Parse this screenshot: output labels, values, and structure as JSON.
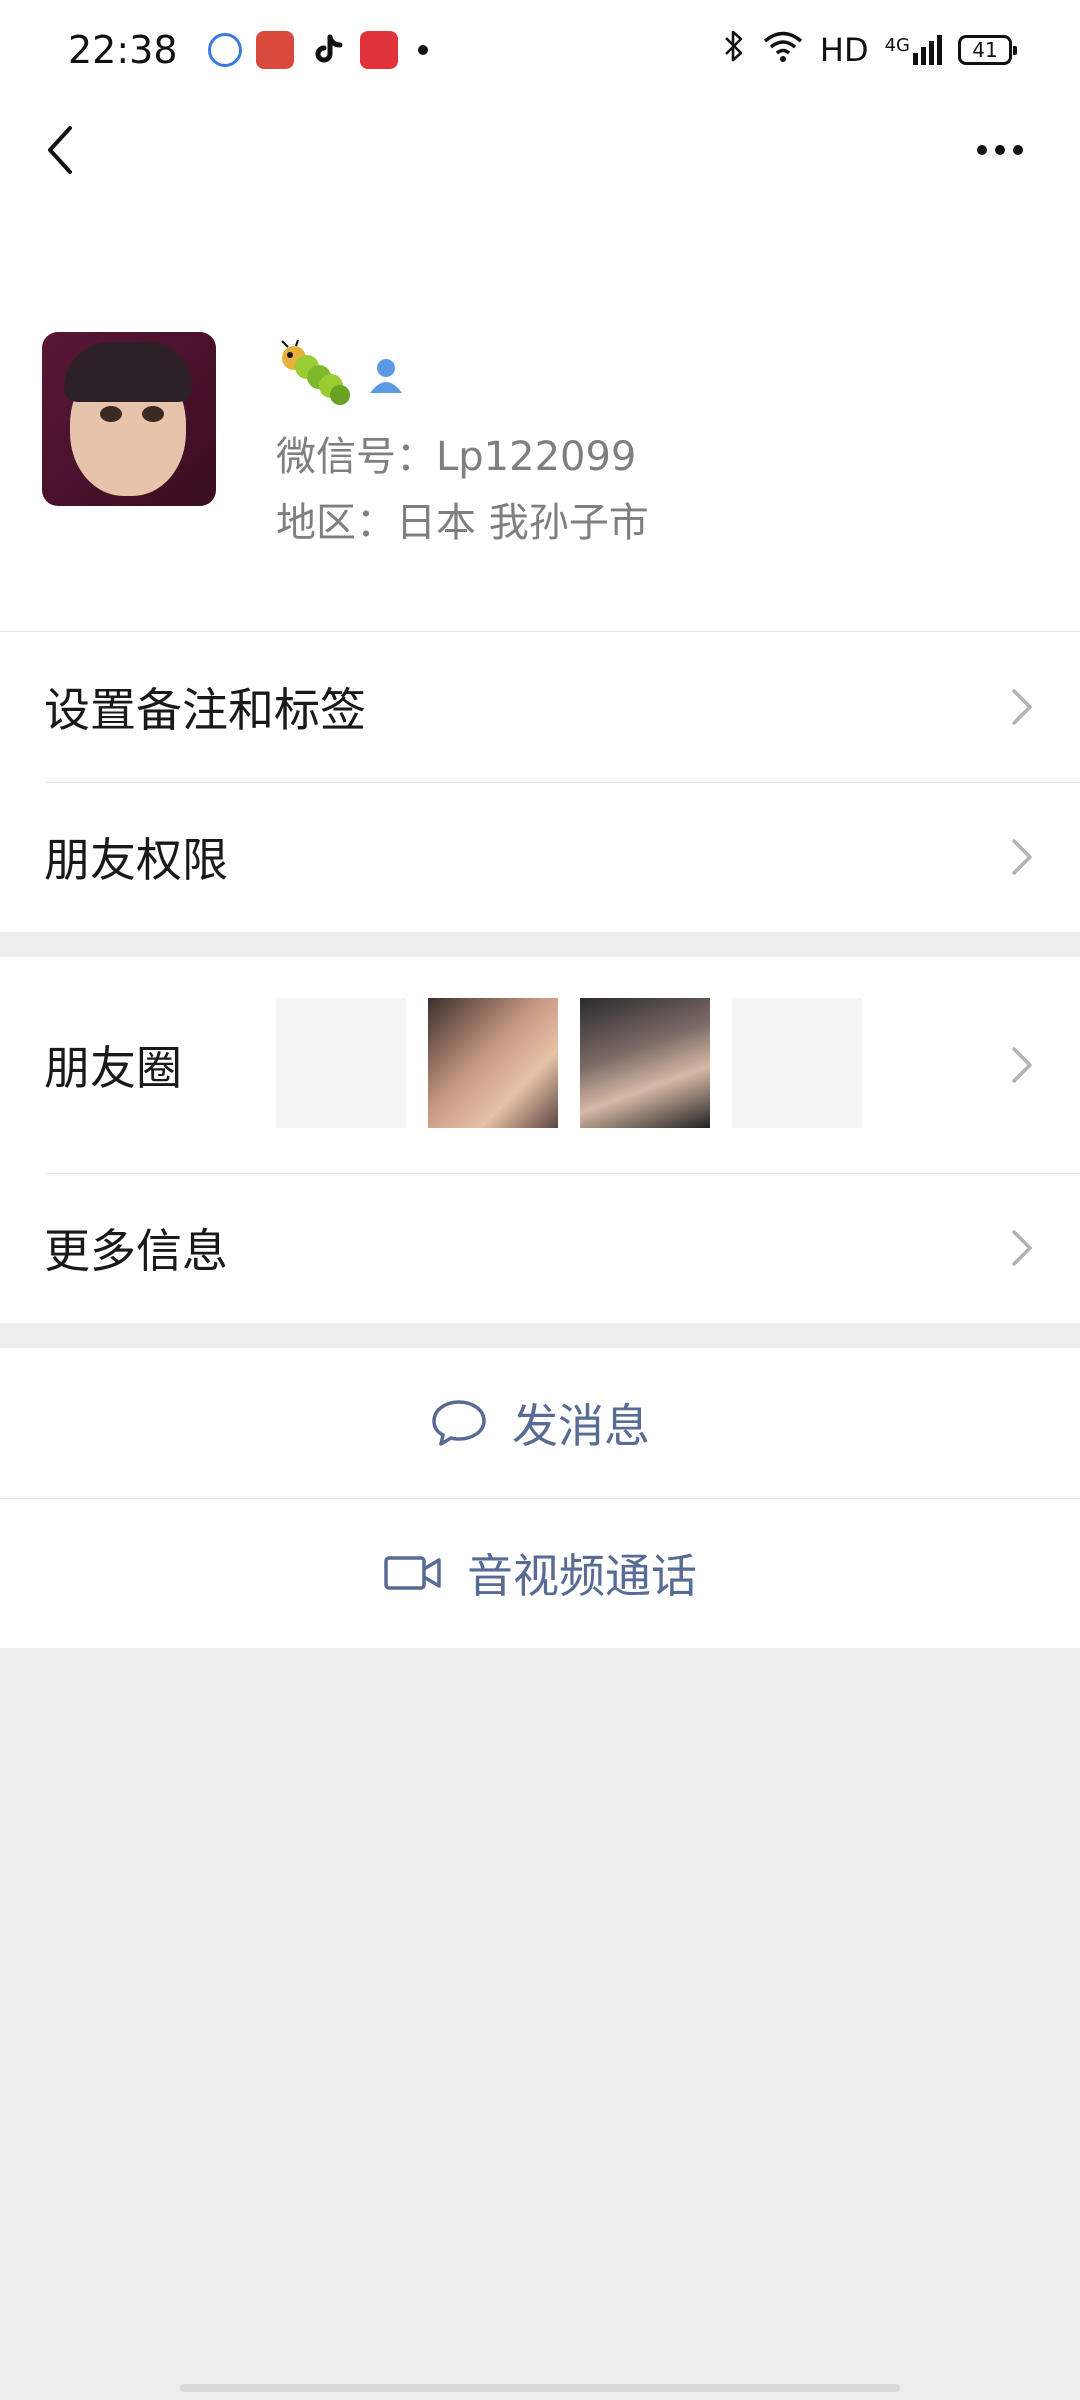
{
  "status_bar": {
    "time": "22:38",
    "network": "HD",
    "cellular": "4G",
    "battery": "41"
  },
  "nav": {
    "back_icon": "chevron-left-icon",
    "more_icon": "more-dots-icon"
  },
  "profile": {
    "nickname_icon": "caterpillar-emoji",
    "wechat_id": "微信号：Lp122099",
    "region": "地区：日本  我孙子市"
  },
  "menu": {
    "remarks_tags": "设置备注和标签",
    "friend_permissions": "朋友权限",
    "moments": "朋友圈",
    "more_info": "更多信息"
  },
  "actions": {
    "send_message": "发消息",
    "video_call": "音视频通话"
  },
  "colors": {
    "link_blue": "#576b95",
    "background": "#ededed",
    "text_secondary": "#7f7f7f"
  }
}
